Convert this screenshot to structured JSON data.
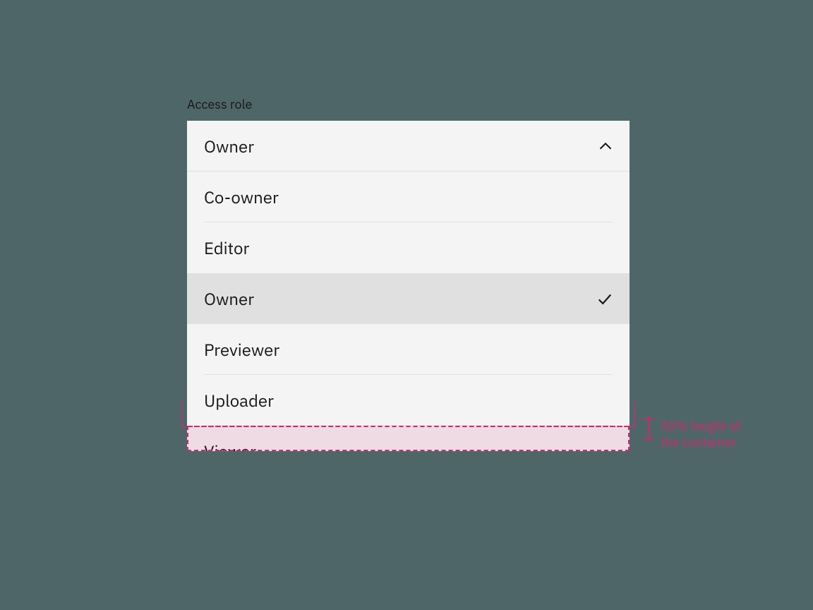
{
  "field": {
    "label": "Access role"
  },
  "dropdown": {
    "selected": "Owner",
    "options": {
      "0": {
        "label": "Co-owner"
      },
      "1": {
        "label": "Editor"
      },
      "2": {
        "label": "Owner"
      },
      "3": {
        "label": "Previewer"
      },
      "4": {
        "label": "Uploader"
      },
      "5": {
        "label": "Viewer"
      }
    },
    "selectedIndex": 2
  },
  "annotation": {
    "line1": "50% height of",
    "line2": "the container"
  },
  "colors": {
    "accent": "#d12771"
  }
}
